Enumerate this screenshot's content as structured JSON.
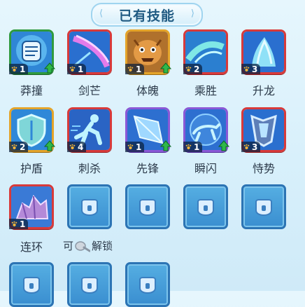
{
  "header": {
    "title": "已有技能"
  },
  "skills": [
    {
      "name": "莽撞",
      "level": "1",
      "upgrade": true,
      "frame": "green",
      "bg": "#2f86d6",
      "icon": "fist-icon"
    },
    {
      "name": "剑芒",
      "level": "1",
      "upgrade": false,
      "frame": "red",
      "bg": "#2a6fcf",
      "icon": "sword-slash-icon"
    },
    {
      "name": "体魄",
      "level": "1",
      "upgrade": true,
      "frame": "gold",
      "bg": "#b0712c",
      "icon": "beast-face-icon"
    },
    {
      "name": "乘胜",
      "level": "2",
      "upgrade": false,
      "frame": "red",
      "bg": "#2b7fd0",
      "icon": "wave-strike-icon"
    },
    {
      "name": "升龙",
      "level": "3",
      "upgrade": false,
      "frame": "red",
      "bg": "#2a6fcf",
      "icon": "rising-dragon-icon"
    },
    {
      "name": "护盾",
      "level": "2",
      "upgrade": true,
      "frame": "gold",
      "bg": "#2f88d8",
      "icon": "shield-icon"
    },
    {
      "name": "刺杀",
      "level": "4",
      "upgrade": false,
      "frame": "red",
      "bg": "#2a64c4",
      "icon": "dashing-figure-icon"
    },
    {
      "name": "先锋",
      "level": "1",
      "upgrade": true,
      "frame": "purple",
      "bg": "#2d6fd0",
      "icon": "crystal-icon"
    },
    {
      "name": "瞬闪",
      "level": "1",
      "upgrade": true,
      "frame": "purple",
      "bg": "#2d6fd0",
      "icon": "running-beast-icon"
    },
    {
      "name": "恃势",
      "level": "3",
      "upgrade": false,
      "frame": "red",
      "bg": "#2a6fcf",
      "icon": "armor-icon"
    },
    {
      "name": "连环",
      "level": "1",
      "upgrade": false,
      "frame": "red",
      "bg": "#3a7ad6",
      "icon": "rock-cluster-icon"
    }
  ],
  "unlock_hint": {
    "prefix": "可",
    "suffix": "解锁",
    "tool_icon": "spoon-tool-icon"
  },
  "locked_slots": 7,
  "colors": {
    "frame_red": "#d83a3a",
    "frame_green": "#2f9a3e",
    "frame_gold": "#e4a42a",
    "frame_purple": "#8a58d6",
    "upgrade_arrow": "#2fb84a",
    "locked_slot": "#3a8ed0"
  }
}
